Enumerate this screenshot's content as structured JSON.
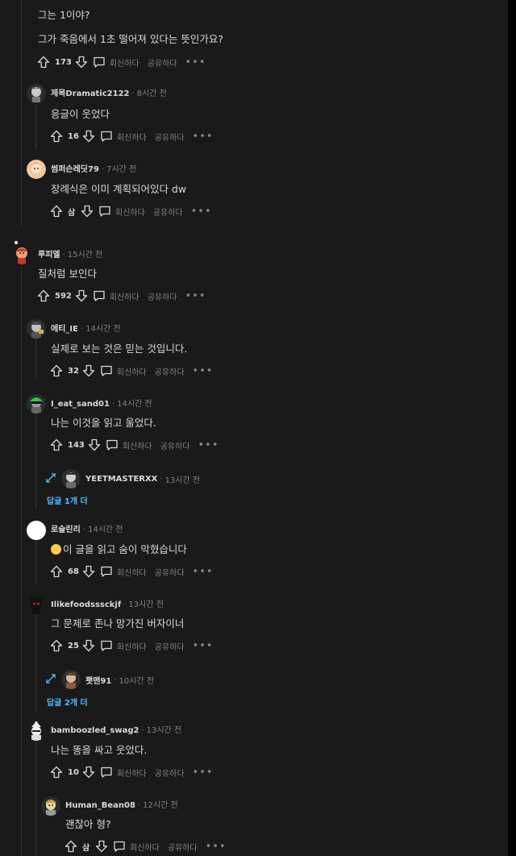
{
  "actions": {
    "reply": "회신하다",
    "share": "공유하다",
    "more": "•••",
    "separator": "·"
  },
  "comments": [
    {
      "id": "c0",
      "user": "",
      "time": "",
      "lines": [
        "그는 1이야?",
        "그가 죽음에서 1초 떨어져 있다는 뜻인가요?"
      ],
      "votes": "173"
    },
    {
      "id": "c1",
      "user": "제목Dramatic2122",
      "time": "8시간 전",
      "lines": [
        "응글이 웃었다"
      ],
      "votes": "16"
    },
    {
      "id": "c2",
      "user": "썸퍼슨레딧79",
      "time": "7시간 전",
      "lines": [
        "장례식은 이미 계획되어있다 dw"
      ],
      "votes": "삼"
    },
    {
      "id": "c3",
      "user": "루피엘",
      "time": "15시간 전",
      "lines": [
        "질처럼 보인다"
      ],
      "votes": "592"
    },
    {
      "id": "c4",
      "user": "에티_IE",
      "time": "14시간 전",
      "lines": [
        "실제로 보는 것은 믿는 것입니다."
      ],
      "votes": "32"
    },
    {
      "id": "c5",
      "user": "I_eat_sand01",
      "time": "14시간 전",
      "lines": [
        "나는 이것을 읽고 울었다."
      ],
      "votes": "143"
    },
    {
      "id": "c6",
      "user": "로슬린리",
      "time": "14시간 전",
      "lines": [
        "이 글을 읽고 숨이 막혔습니다"
      ],
      "votes": "68"
    },
    {
      "id": "c7",
      "user": "Ilikefoodsssckjf",
      "time": "13시간 전",
      "lines": [
        "그 문제로 존나 망가진 버자이너"
      ],
      "votes": "25"
    },
    {
      "id": "c8",
      "user": "bamboozled_swag2",
      "time": "13시간 전",
      "lines": [
        "나는 똥을 싸고 웃었다."
      ],
      "votes": "10"
    },
    {
      "id": "c9",
      "user": "Human_Bean08",
      "time": "12시간 전",
      "lines": [
        "괜찮아 형?"
      ],
      "votes": "삼"
    }
  ],
  "collapsed": [
    {
      "id": "x1",
      "user": "YEETMASTERXX",
      "time": "13시간 전",
      "more": "답글 1개 더"
    },
    {
      "id": "x2",
      "user": "쾟맨91",
      "time": "10시간 전",
      "more": "답글 2개 더"
    }
  ],
  "colors": {
    "background": "#1a1a1b",
    "text": "#d7dadc",
    "muted": "#818384",
    "link": "#4fbcff",
    "thread": "#343536"
  }
}
